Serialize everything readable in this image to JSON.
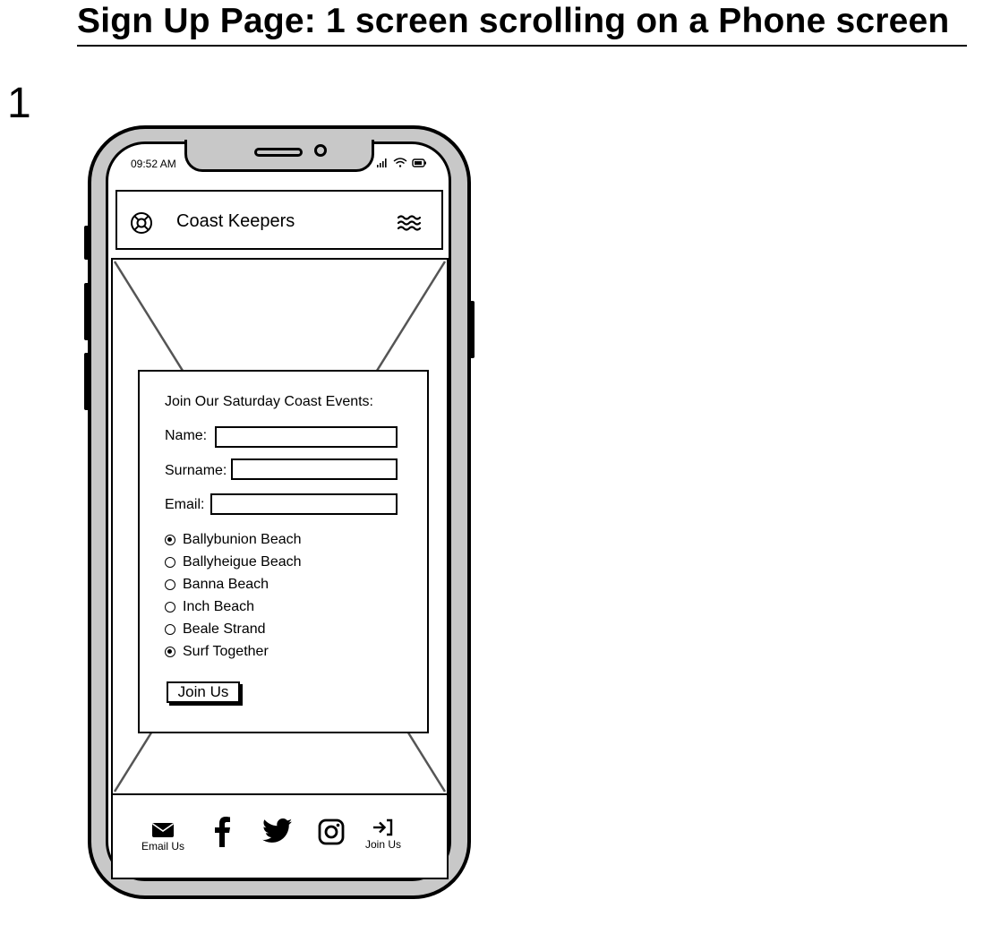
{
  "page": {
    "title": "Sign Up Page: 1 screen scrolling on a Phone screen",
    "screen_number": "1"
  },
  "status_bar": {
    "time": "09:52 AM",
    "icons": [
      "signal-icon",
      "wifi-icon",
      "battery-icon"
    ]
  },
  "header": {
    "logo_icon": "lifebuoy-icon",
    "brand": "Coast Keepers",
    "menu_icon": "waves-menu-icon"
  },
  "form": {
    "heading": "Join Our Saturday Coast Events:",
    "fields": [
      {
        "label": "Name:",
        "value": ""
      },
      {
        "label": "Surname:",
        "value": ""
      },
      {
        "label": "Email:",
        "value": ""
      }
    ],
    "options": [
      {
        "label": "Ballybunion Beach",
        "selected": true
      },
      {
        "label": "Ballyheigue Beach",
        "selected": false
      },
      {
        "label": "Banna Beach",
        "selected": false
      },
      {
        "label": "Inch Beach",
        "selected": false
      },
      {
        "label": "Beale Strand",
        "selected": false
      },
      {
        "label": "Surf Together",
        "selected": true
      }
    ],
    "submit_label": "Join Us"
  },
  "footer": {
    "email_label": "Email Us",
    "join_label": "Join Us",
    "icons": [
      "envelope-icon",
      "facebook-icon",
      "twitter-icon",
      "instagram-icon",
      "sign-in-icon"
    ]
  }
}
